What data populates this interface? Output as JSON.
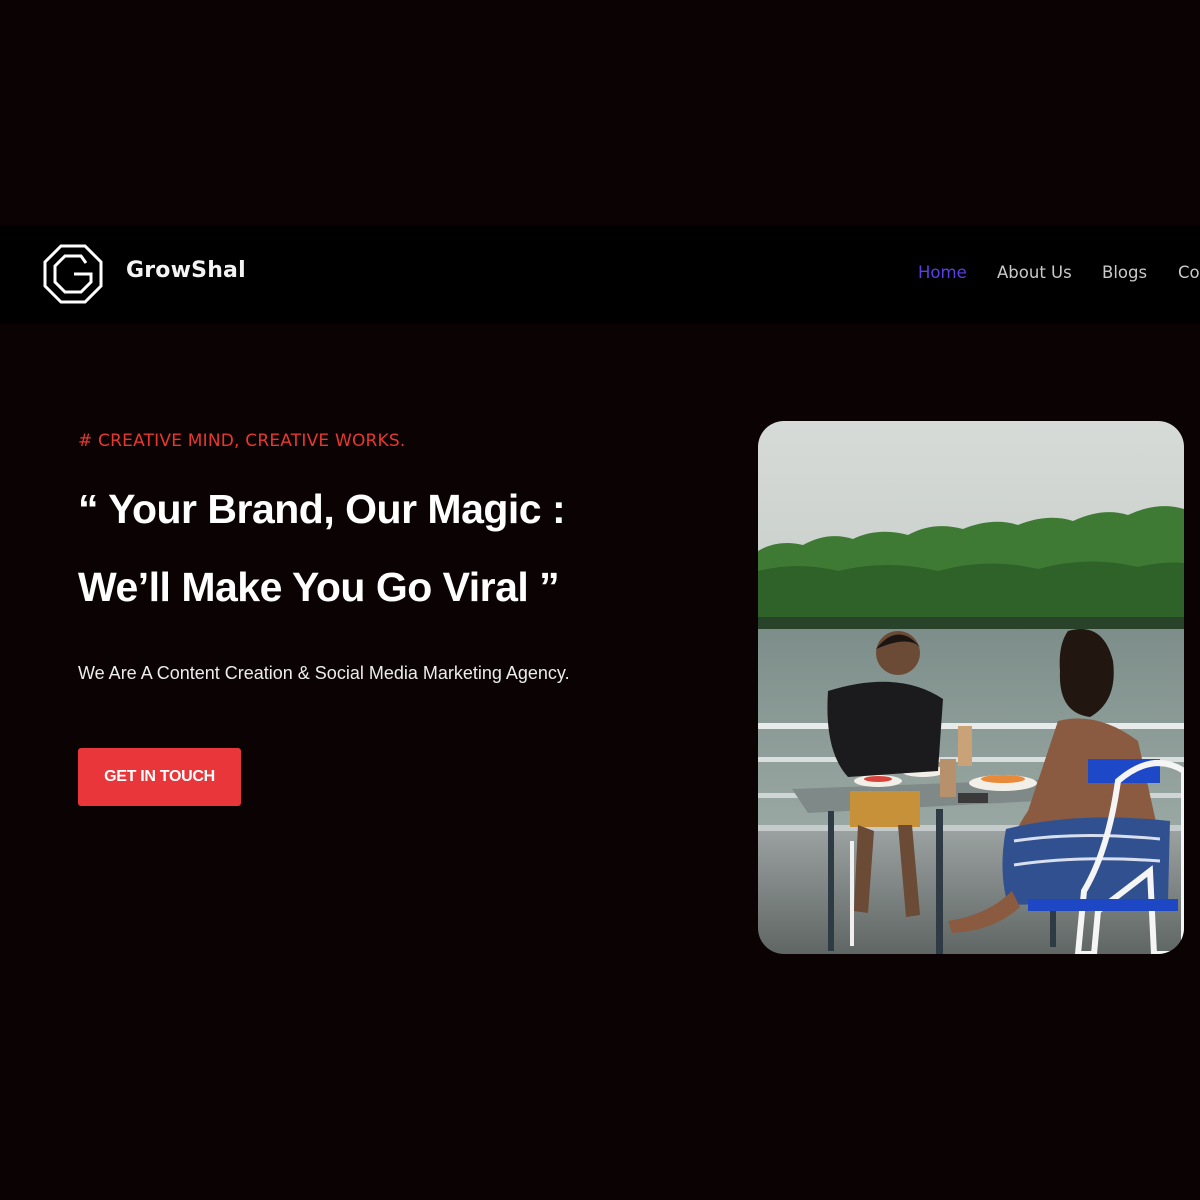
{
  "header": {
    "brand_name": "GrowShal",
    "logo_icon": "octagon-g-logo-icon",
    "nav": {
      "home": "Home",
      "about": "About Us",
      "blogs": "Blogs",
      "contact": "Co"
    },
    "active_color": "#5b3ee8"
  },
  "hero": {
    "tagline": "# CREATIVE MIND, CREATIVE WORKS.",
    "headline_line1": "“ Your Brand, Our Magic :",
    "headline_line2": "We’ll Make You Go Viral ”",
    "subtext": "We Are A Content Creation & Social Media Marketing Agency.",
    "cta_label": "GET IN TOUCH",
    "accent_color": "#e8363a",
    "image": "photo-couple-dining-by-lake"
  }
}
